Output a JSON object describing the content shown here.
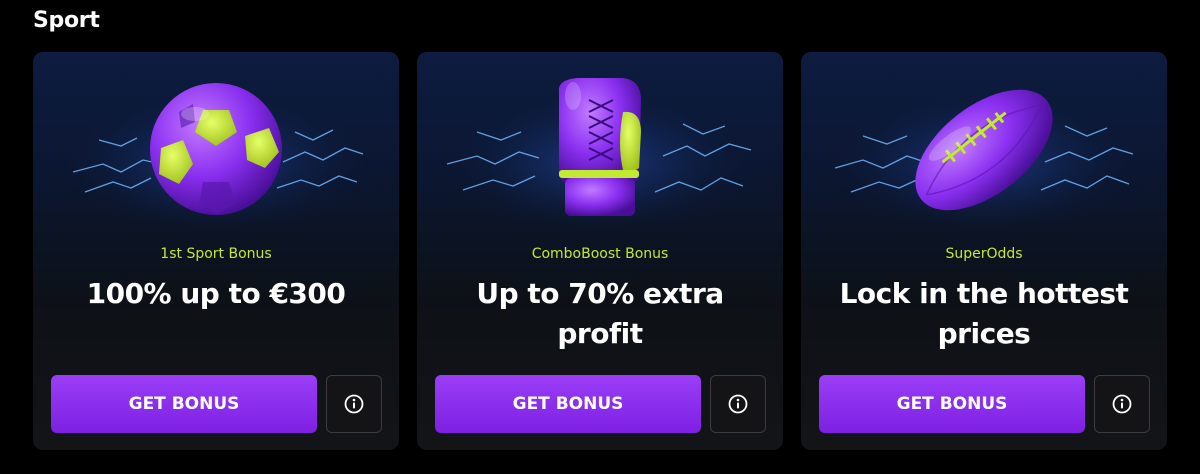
{
  "section": {
    "title": "Sport"
  },
  "cards": [
    {
      "image": "soccer-ball-icon",
      "subtitle": "1st Sport Bonus",
      "headline_lines": [
        "100% up to €300"
      ],
      "button_label": "GET BONUS",
      "info_icon": "info-icon"
    },
    {
      "image": "boxing-glove-icon",
      "subtitle": "ComboBoost Bonus",
      "headline_lines": [
        "Up to 70% extra",
        "profit"
      ],
      "button_label": "GET BONUS",
      "info_icon": "info-icon"
    },
    {
      "image": "american-football-icon",
      "subtitle": "SuperOdds",
      "headline_lines": [
        "Lock in the hottest",
        "prices"
      ],
      "button_label": "GET BONUS",
      "info_icon": "info-icon"
    }
  ],
  "colors": {
    "accent": "#8a2ff0",
    "subtitle": "#c2ea2e",
    "background": "#000000",
    "card": "#101318"
  }
}
